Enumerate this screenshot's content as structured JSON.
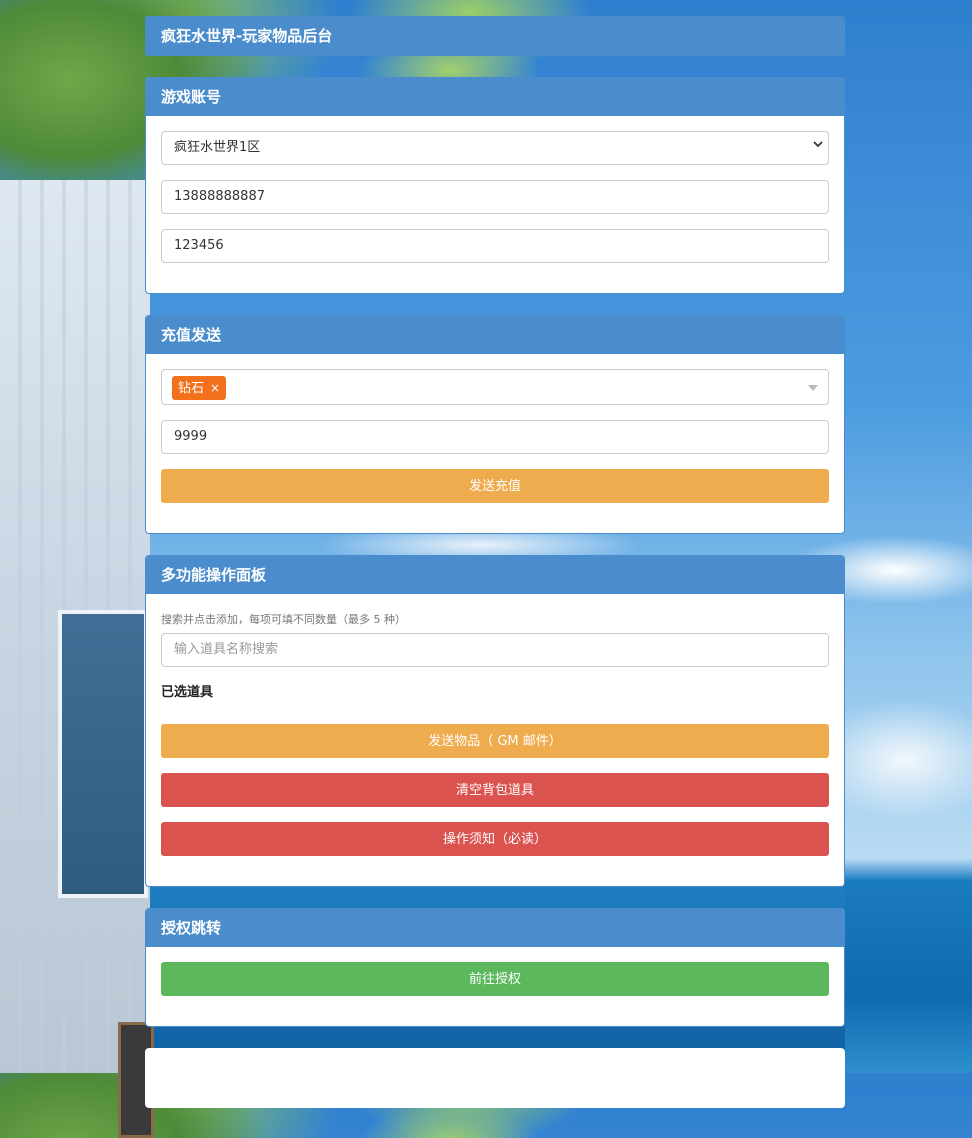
{
  "app_title": "疯狂水世界-玩家物品后台",
  "account_panel": {
    "title": "游戏账号",
    "server_select": {
      "selected": "疯狂水世界1区"
    },
    "account_input": {
      "value": "13888888887"
    },
    "password_input": {
      "value": "123456"
    }
  },
  "recharge_panel": {
    "title": "充值发送",
    "selected_tags": [
      {
        "label": "钻石",
        "remove": "×",
        "color": "#f2711c"
      }
    ],
    "amount_input": {
      "value": "9999"
    },
    "send_button": "发送充值"
  },
  "multi_panel": {
    "title": "多功能操作面板",
    "hint": "搜索并点击添加，每项可填不同数量（最多 5 种）",
    "search_placeholder": "输入道具名称搜索",
    "selected_label": "已选道具",
    "send_items_button": "发送物品（ GM 邮件）",
    "clear_bag_button": "清空背包道具",
    "notice_button": "操作须知（必读）"
  },
  "auth_panel": {
    "title": "授权跳转",
    "go_button": "前往授权"
  },
  "colors": {
    "header": "#4a8ccc",
    "warning": "#efac4e",
    "danger": "#db534f",
    "success": "#5cb85c",
    "tag": "#f2711c"
  }
}
